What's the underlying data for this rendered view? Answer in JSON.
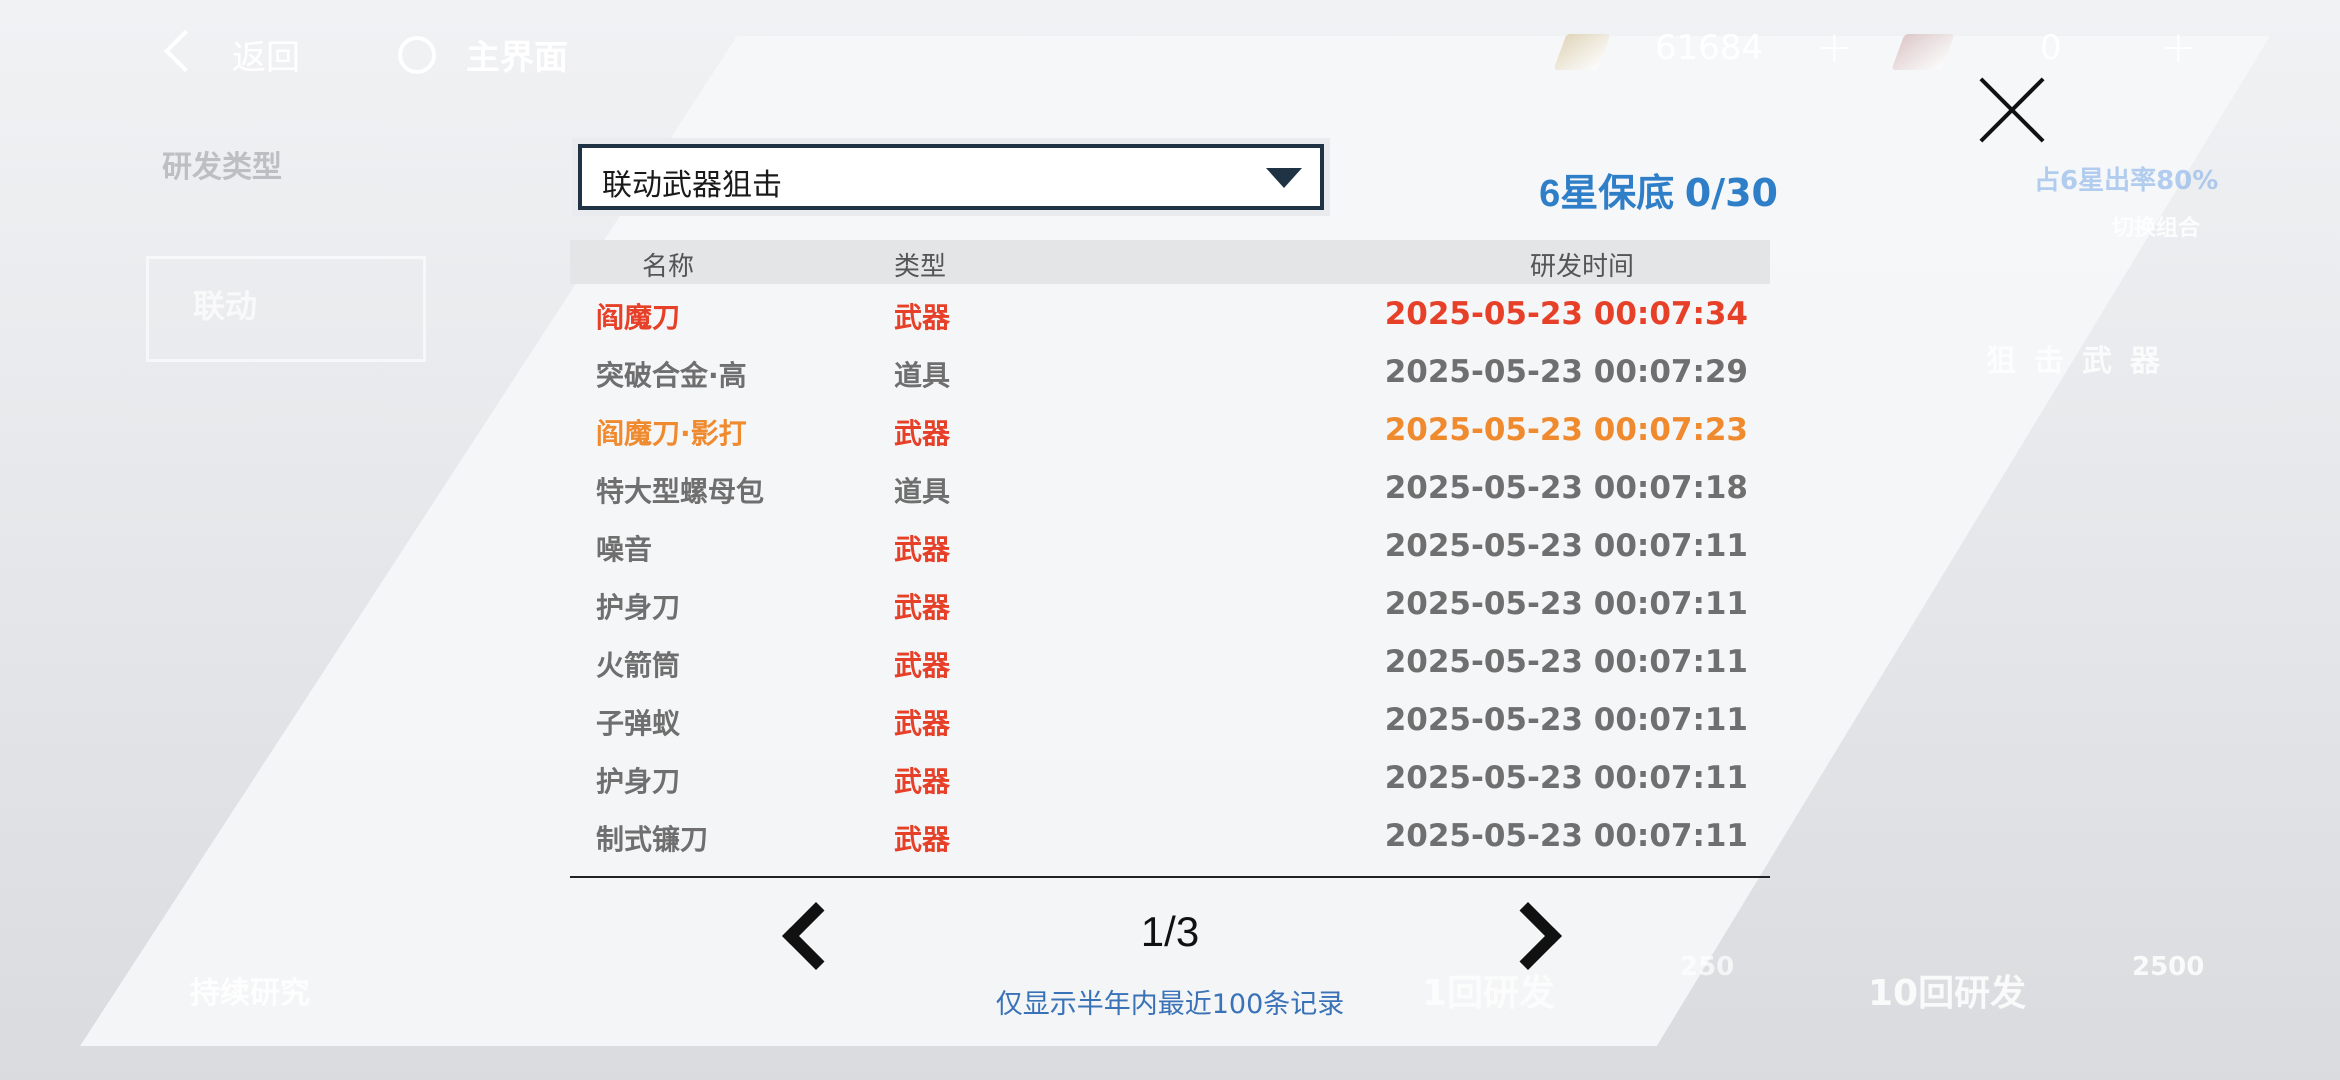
{
  "topbar": {
    "back_label": "返回",
    "home_label": "主界面",
    "currency1_value": "61684",
    "currency2_value": "0",
    "plus_label": "+"
  },
  "dialog": {
    "select_value": "联动武器狙击",
    "pity": {
      "prefix": "6星保底 ",
      "value": "0/30"
    },
    "columns": {
      "name": "名称",
      "type": "类型",
      "time": "研发时间"
    },
    "rows": [
      {
        "name": "阎魔刀",
        "type": "武器",
        "time": "2025-05-23 00:07:34",
        "rarity": "red"
      },
      {
        "name": "突破合金·高",
        "type": "道具",
        "time": "2025-05-23 00:07:29",
        "rarity": "gray"
      },
      {
        "name": "阎魔刀·影打",
        "type": "武器",
        "time": "2025-05-23 00:07:23",
        "rarity": "orange"
      },
      {
        "name": "特大型螺母包",
        "type": "道具",
        "time": "2025-05-23 00:07:18",
        "rarity": "gray"
      },
      {
        "name": "噪音",
        "type": "武器",
        "time": "2025-05-23 00:07:11",
        "rarity": "gray"
      },
      {
        "name": "护身刀",
        "type": "武器",
        "time": "2025-05-23 00:07:11",
        "rarity": "gray"
      },
      {
        "name": "火箭筒",
        "type": "武器",
        "time": "2025-05-23 00:07:11",
        "rarity": "gray"
      },
      {
        "name": "子弹蚁",
        "type": "武器",
        "time": "2025-05-23 00:07:11",
        "rarity": "gray"
      },
      {
        "name": "护身刀",
        "type": "武器",
        "time": "2025-05-23 00:07:11",
        "rarity": "gray"
      },
      {
        "name": "制式镰刀",
        "type": "武器",
        "time": "2025-05-23 00:07:11",
        "rarity": "gray"
      }
    ],
    "page": "1/3",
    "note": "仅显示半年内最近100条记录"
  },
  "background": {
    "left_title": "研发类型",
    "left_card": "联动",
    "right_rate": "占6星出率80%",
    "right_switch": "切换组合",
    "right_label": "狙击武器",
    "bottom_left": "持续研究",
    "btn1": "1回研发",
    "btn1_cost": "250",
    "btn10": "10回研发",
    "btn10_cost": "2500"
  }
}
